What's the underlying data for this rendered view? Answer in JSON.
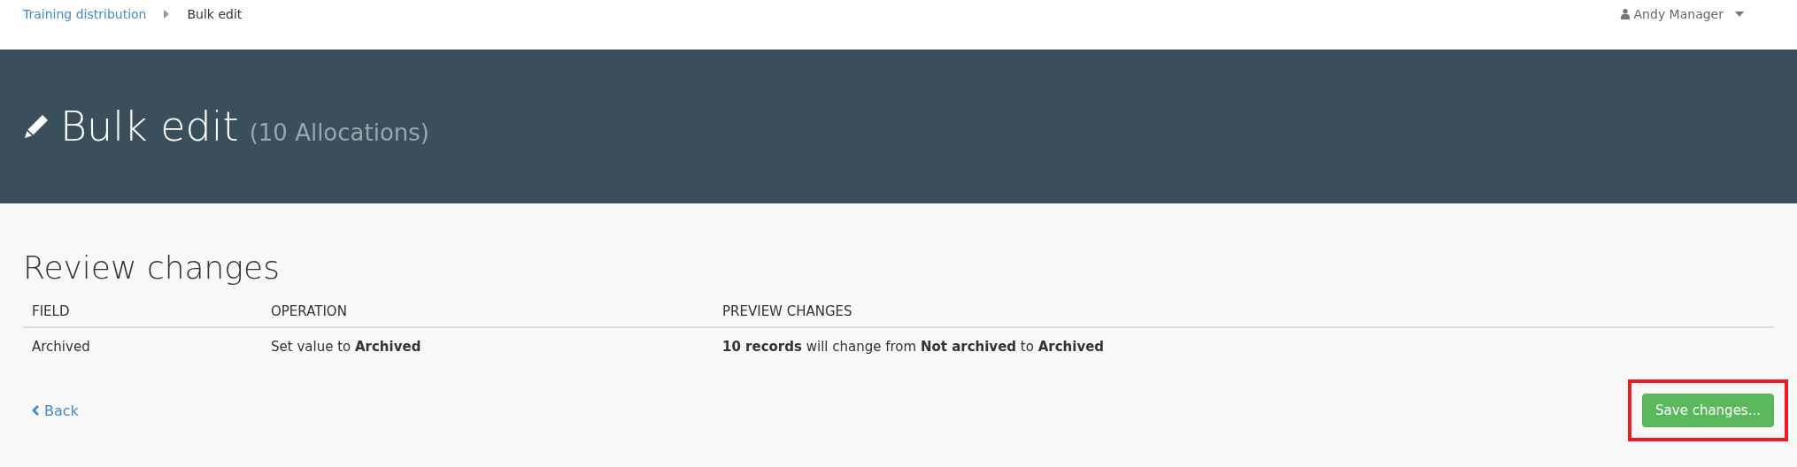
{
  "breadcrumb": [
    {
      "label": "Training distribution",
      "link": true
    },
    {
      "label": "Bulk edit",
      "link": false
    }
  ],
  "user_menu": {
    "label": "Andy Manager"
  },
  "header": {
    "title": "Bulk edit",
    "subtitle": "(10 Allocations)"
  },
  "section_title": "Review changes",
  "table": {
    "columns": [
      "FIELD",
      "OPERATION",
      "PREVIEW CHANGES"
    ],
    "rows": [
      [
        "Archived",
        "Set value to **Archived**",
        "**10 records** will change from **Not archived** to **Archived**"
      ]
    ]
  },
  "back_link": "Back",
  "save_button": {
    "label": "Save changes...",
    "highlighted": true
  }
}
